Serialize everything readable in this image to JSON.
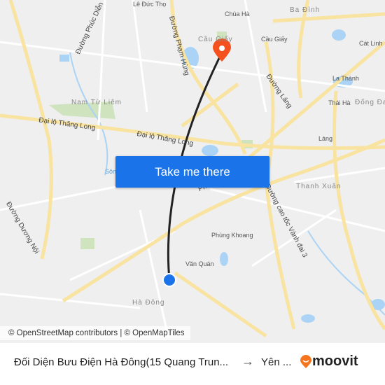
{
  "map": {
    "labels": {
      "le_duc_tho": "Lê Đức Thọ",
      "chua_ha": "Chùa Hà",
      "ba_dinh": "Ba Đình",
      "cau_giay_area": "Cầu Giấy",
      "cau_giay": "Cầu Giấy",
      "cat_linh": "Cát Linh",
      "la_thanh": "La Thành",
      "thai_ha": "Thái Hà",
      "dong_da": "Đống Đa",
      "nam_tu_liem": "Nam Từ Liêm",
      "dai_lo_thang_long_1": "Đại lộ Thăng Long",
      "dai_lo_thang_long_2": "Đại lộ Thăng Long",
      "duong_pham_hung": "Đường Phạm Hùng",
      "duong_phuc_dien": "Đường Phúc Diễn",
      "duong_lang": "Đường Láng",
      "lang": "Láng",
      "thanh_xuan": "Thanh Xuân",
      "phung_khoang": "Phùng Khoang",
      "van_quan": "Văn Quán",
      "ha_dong": "Hà Đông",
      "duong_duong_noi": "Đường Dương Nội",
      "cao_toc": "Đường cao tốc Vành đai 3",
      "song": "Sôn",
      "pho": "Phố"
    },
    "destination_pin_color": "#f4511e",
    "origin_marker_color": "#1a73e8",
    "route_color": "#222222"
  },
  "cta": {
    "label": "Take me there"
  },
  "attribution": "© OpenStreetMap contributors | © OpenMapTiles",
  "footer": {
    "from": "Đối Diện Bưu Điện Hà Đông(15 Quang Trun...",
    "arrow": "→",
    "to": "Yên ...",
    "logo": "moovit"
  }
}
